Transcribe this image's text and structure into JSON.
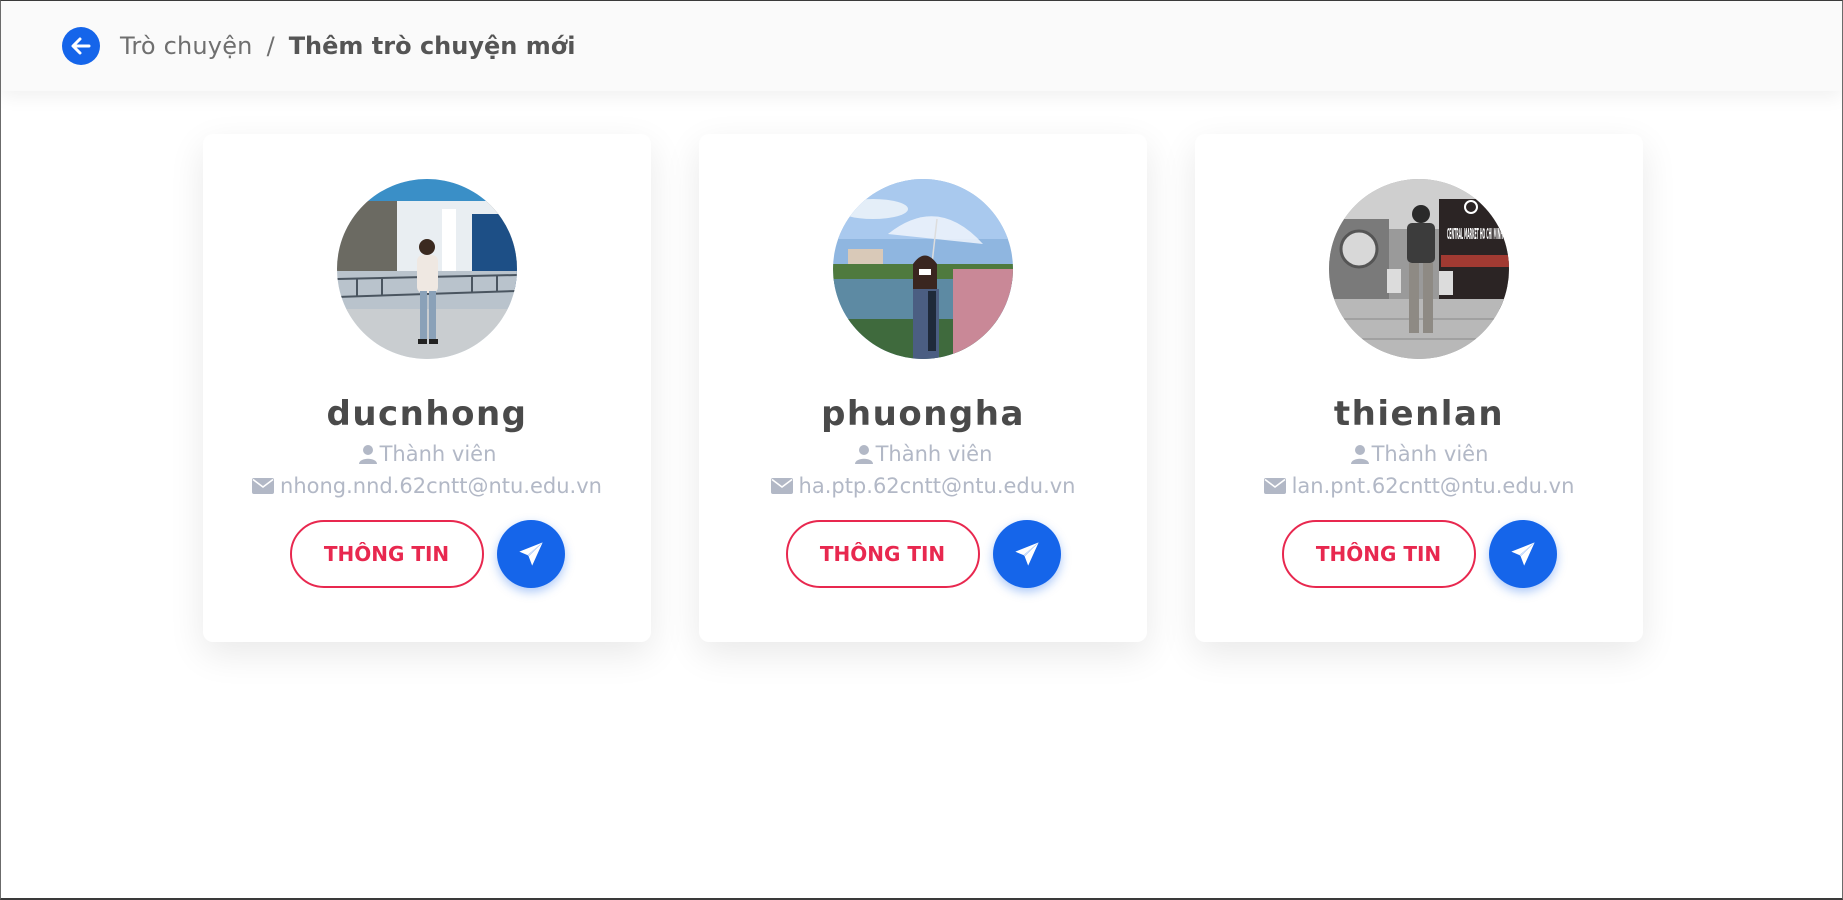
{
  "header": {
    "breadcrumb_root": "Trò chuyện",
    "separator": "/",
    "current_page": "Thêm trò chuyện mới",
    "back_icon": "arrow-left-icon",
    "accent_color": "#1565ea"
  },
  "users": [
    {
      "username": "ducnhong",
      "role": "Thành viên",
      "email": "nhong.nnd.62cntt@ntu.edu.vn",
      "info_label": "THÔNG TIN",
      "send_icon": "paper-plane-icon"
    },
    {
      "username": "phuongha",
      "role": "Thành viên",
      "email": "ha.ptp.62cntt@ntu.edu.vn",
      "info_label": "THÔNG TIN",
      "send_icon": "paper-plane-icon"
    },
    {
      "username": "thienlan",
      "role": "Thành viên",
      "email": "lan.pnt.62cntt@ntu.edu.vn",
      "info_label": "THÔNG TIN",
      "send_icon": "paper-plane-icon"
    }
  ],
  "colors": {
    "primary": "#1565ea",
    "danger": "#e8284f",
    "muted_text": "#b2b8c6"
  },
  "photo_overlay_text": "CENTRAL MARKET HO CHI MINH"
}
